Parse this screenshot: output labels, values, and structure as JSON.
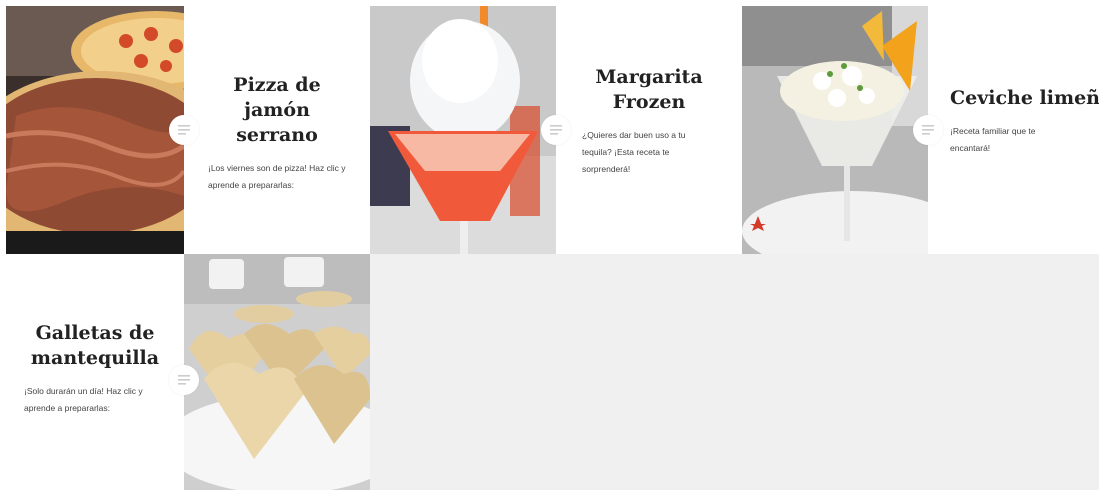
{
  "posts": [
    {
      "title": "Pizza de jamón serrano",
      "excerpt": "¡Los viernes son de pizza! Haz clic y aprende a prepararlas:",
      "image_icon": "pizza-photo"
    },
    {
      "title": "Margarita Frozen",
      "excerpt": "¿Quieres dar buen uso a tu tequila? ¡Esta receta te sorprenderá!",
      "image_icon": "margarita-photo"
    },
    {
      "title": "Ceviche limeño",
      "excerpt": "¡Receta familiar que te encantará!",
      "image_icon": "ceviche-photo"
    },
    {
      "title": "Galletas de mantequilla",
      "excerpt": "¡Solo durarán un día! Haz clic y aprende a prepararlas:",
      "image_icon": "cookies-photo"
    }
  ],
  "post_format_icon": "standard-post-icon",
  "colors": {
    "page_background": "#ffffff",
    "grid_background": "#f0f0f0",
    "text_cell": "#ffffff",
    "title_text": "#222222",
    "icon_lines": "#cccccc"
  }
}
